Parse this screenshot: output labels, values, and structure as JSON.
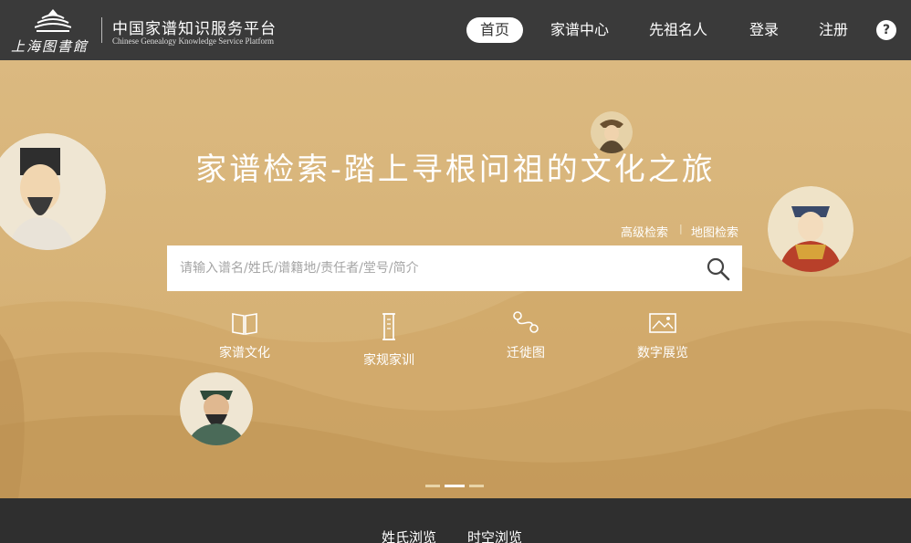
{
  "header": {
    "logo_text": "上海图書館",
    "platform_name_cn": "中国家谱知识服务平台",
    "platform_name_en": "Chinese Genealogy Knowledge Service Platform",
    "nav": {
      "home": "首页",
      "family": "家谱中心",
      "ancestors": "先祖名人",
      "login": "登录",
      "register": "注册"
    },
    "help": "?"
  },
  "banner": {
    "title": "家谱检索-踏上寻根问祖的文化之旅",
    "advanced_search": "高级检索",
    "separator": "|",
    "map_search": "地图检索",
    "search_placeholder": "请输入谱名/姓氏/谱籍地/责任者/堂号/简介",
    "quick_links": {
      "culture": "家谱文化",
      "rules": "家规家训",
      "migration": "迁徙图",
      "exhibition": "数字展览"
    },
    "carousel_active": 2,
    "carousel_count": 3
  },
  "tabs": {
    "surname": "姓氏浏览",
    "spacetime": "时空浏览"
  },
  "colors": {
    "header_bg": "#3a3a3a",
    "banner_bg": "#d9b77f",
    "bottom_bg": "#2f2f2f"
  }
}
